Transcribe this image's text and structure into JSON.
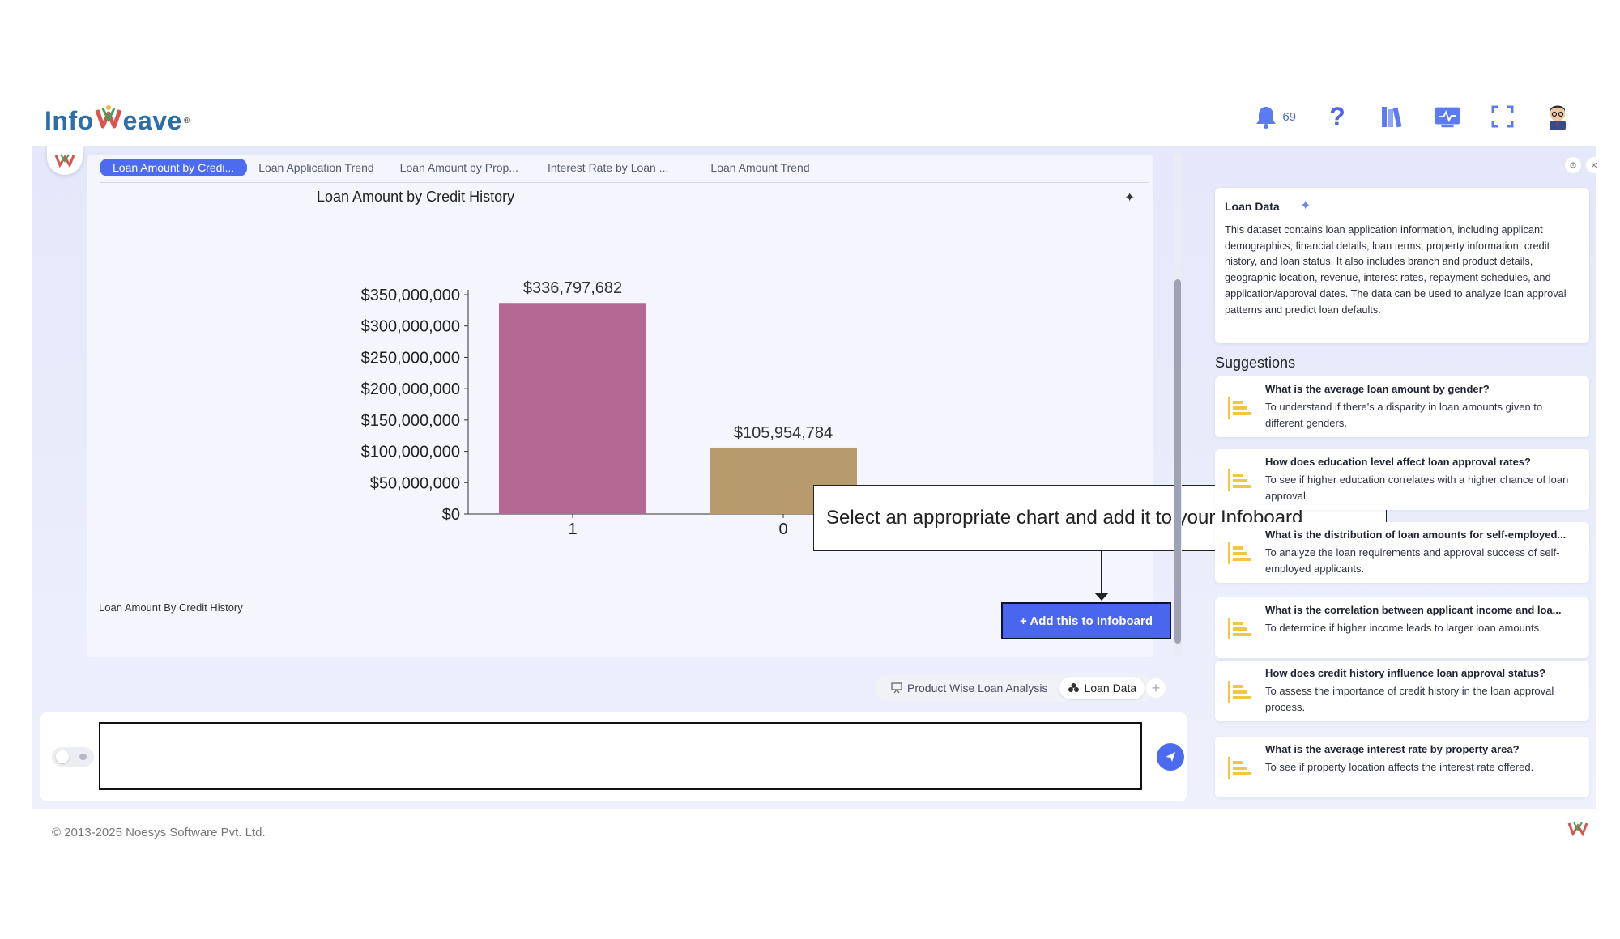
{
  "header": {
    "logo_text_a": "Info",
    "logo_text_b": "eave",
    "logo_reg": "®",
    "notification_count": "69",
    "icons": [
      "bell-icon",
      "help-icon",
      "library-icon",
      "monitor-icon",
      "fullscreen-icon",
      "user-avatar"
    ]
  },
  "tabs": [
    {
      "label": "Loan Amount by Credi...",
      "active": true
    },
    {
      "label": "Loan Application Trend"
    },
    {
      "label": "Loan Amount by Prop..."
    },
    {
      "label": "Interest Rate by Loan ..."
    },
    {
      "label": "Loan Amount Trend"
    }
  ],
  "chart_data": {
    "type": "bar",
    "title": "Loan Amount by Credit History",
    "categories": [
      "1",
      "0"
    ],
    "values": [
      336797682,
      105954784
    ],
    "data_labels": [
      "$336,797,682",
      "$105,954,784"
    ],
    "colors": [
      "#b56893",
      "#b89b6c"
    ],
    "ylim": [
      0,
      350000000
    ],
    "yticks": [
      "$0",
      "$50,000,000",
      "$100,000,000",
      "$150,000,000",
      "$200,000,000",
      "$250,000,000",
      "$300,000,000",
      "$350,000,000"
    ],
    "xlabel": "",
    "ylabel": "",
    "grid": false
  },
  "chart_footnote": "Loan Amount By Credit History",
  "add_button_label": "+ Add this to Infoboard",
  "callout_text": "Select an appropriate chart and add it to your Infoboard",
  "dataset_tabs": [
    {
      "label": "Product Wise Loan Analysis"
    },
    {
      "label": "Loan Data",
      "active": true
    }
  ],
  "chat_input": {
    "value": "",
    "placeholder": ""
  },
  "dataset": {
    "title": "Loan Data",
    "description": "This dataset contains loan application information, including applicant demographics, financial details, loan terms, property information, credit history, and loan status. It also includes branch and product details, geographic location, revenue, interest rates, repayment schedules, and application/approval dates. The data can be used to analyze loan approval patterns and predict loan defaults."
  },
  "suggestions_heading": "Suggestions",
  "suggestions": [
    {
      "q": "What is the average loan amount by gender?",
      "d": "To understand if there's a disparity in loan amounts given to different genders."
    },
    {
      "q": "How does education level affect loan approval rates?",
      "d": "To see if higher education correlates with a higher chance of loan approval."
    },
    {
      "q": "What is the distribution of loan amounts for self-employed...",
      "d": "To analyze the loan requirements and approval success of self-employed applicants."
    },
    {
      "q": "What is the correlation between applicant income and loa...",
      "d": "To determine if higher income leads to larger loan amounts."
    },
    {
      "q": "How does credit history influence loan approval status?",
      "d": "To assess the importance of credit history in the loan approval process."
    },
    {
      "q": "What is the average interest rate by property area?",
      "d": "To see if property location affects the interest rate offered."
    }
  ],
  "footer": "© 2013-2025 Noesys Software Pvt. Ltd.",
  "colors": {
    "accent": "#4d6bf0",
    "panel": "#e4e8fa"
  }
}
